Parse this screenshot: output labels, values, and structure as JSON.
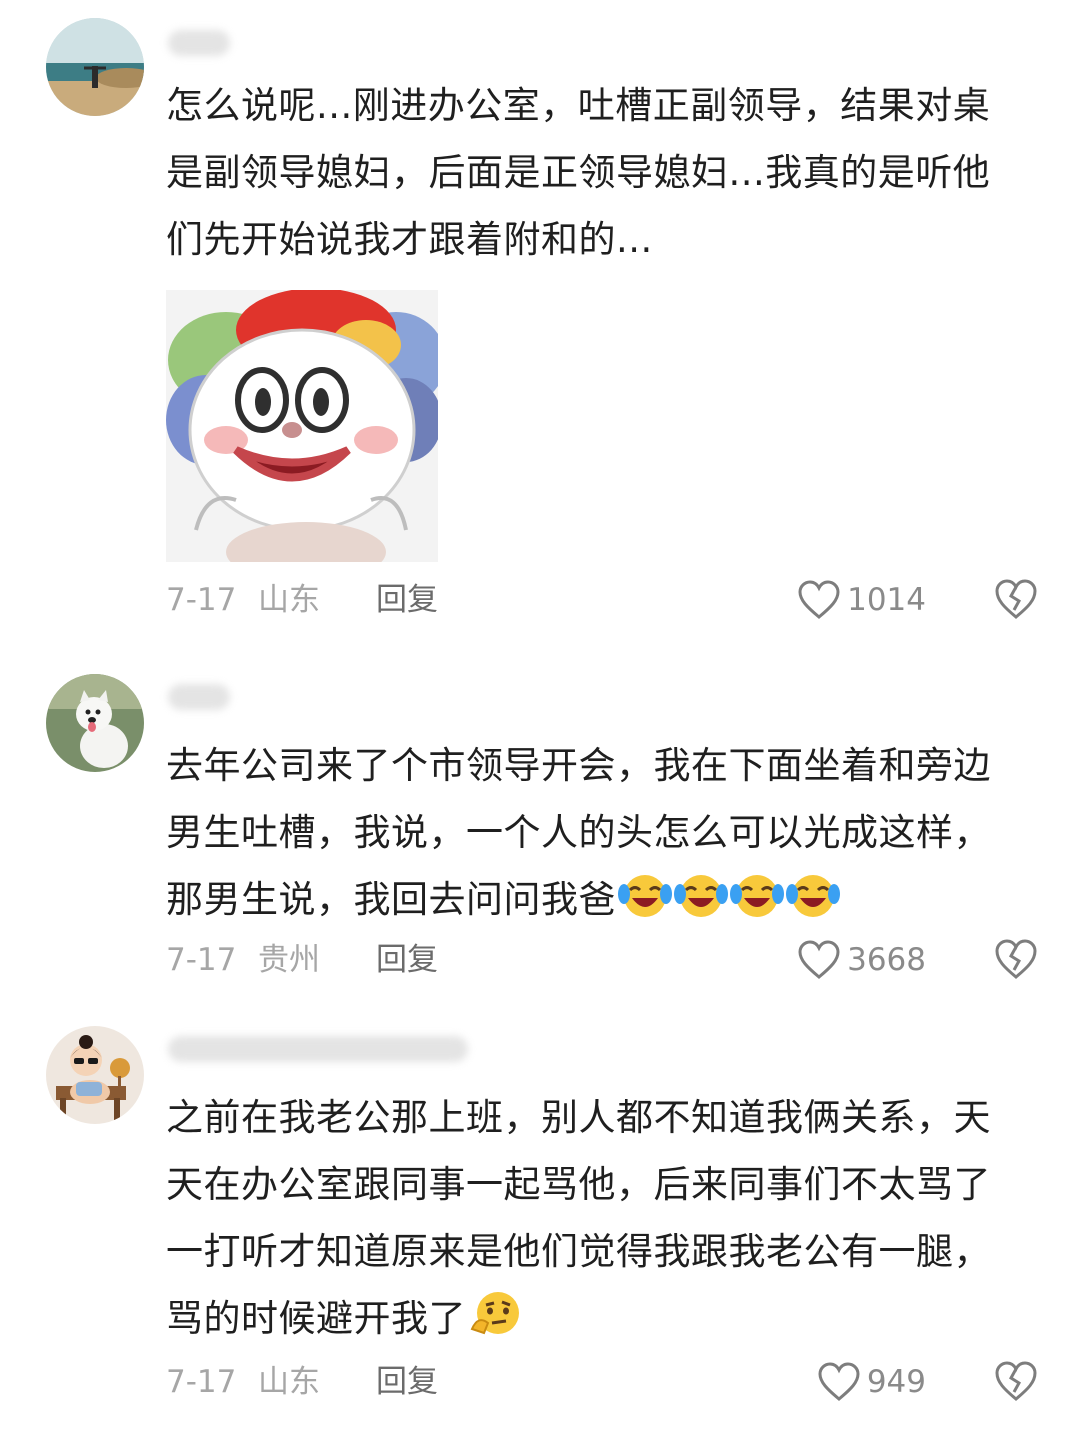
{
  "comments": [
    {
      "text": "怎么说呢...刚进办公室，吐槽正副领导，结果对桌是副领导媳妇，后面是正领导媳妇...我真的是听他们先开始说我才跟着附和的...",
      "date": "7-17",
      "location": "山东",
      "reply_label": "回复",
      "likes": "1014",
      "avatar_icon": "beach-person-avatar",
      "sticker_icon": "clown-face-sticker"
    },
    {
      "text": "去年公司来了个市领导开会，我在下面坐着和旁边男生吐槽，我说，一个人的头怎么可以光成这样，那男生说，我回去问问我爸",
      "emoji_icon": "crying-laughing-emoji",
      "emoji_count": 4,
      "date": "7-17",
      "location": "贵州",
      "reply_label": "回复",
      "likes": "3668",
      "avatar_icon": "white-dog-avatar"
    },
    {
      "text": "之前在我老公那上班，别人都不知道我俩关系，天天在办公室跟同事一起骂他，后来同事们不太骂了一打听才知道原来是他们觉得我跟我老公有一腿，骂的时候避开我了",
      "emoji_icon": "thinking-emoji",
      "date": "7-17",
      "location": "山东",
      "reply_label": "回复",
      "likes": "949",
      "avatar_icon": "cartoon-girl-avatar"
    }
  ],
  "colors": {
    "text": "#1f1f1f",
    "meta": "#a6a6a6",
    "reply": "#6b6b6b"
  }
}
